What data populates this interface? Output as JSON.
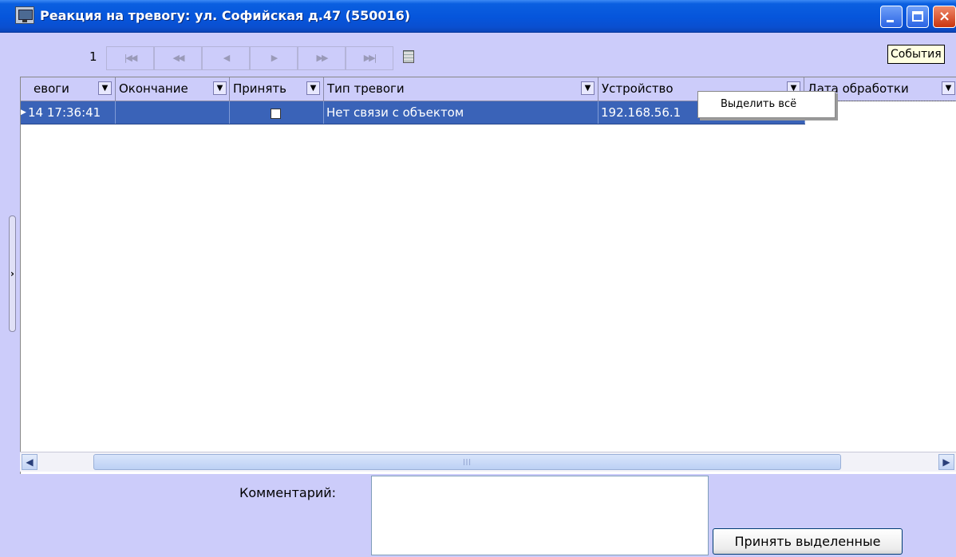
{
  "window": {
    "title": "Реакция на тревогу: ул. Софийская д.47 (550016)",
    "icon": "monitor-icon",
    "buttons": {
      "minimize": "minimize-icon",
      "maximize": "maximize-icon",
      "close": "×"
    }
  },
  "navigator": {
    "page": "1",
    "buttons": [
      {
        "name": "nav-first-button",
        "glyph": "|◀◀"
      },
      {
        "name": "nav-prev-page-button",
        "glyph": "◀◀"
      },
      {
        "name": "nav-prev-button",
        "glyph": "◀"
      },
      {
        "name": "nav-next-button",
        "glyph": "▶"
      },
      {
        "name": "nav-next-page-button",
        "glyph": "▶▶"
      },
      {
        "name": "nav-last-button",
        "glyph": "▶▶|"
      }
    ],
    "tooltip": "События"
  },
  "grid": {
    "columns": [
      "евоги",
      "Окончание",
      "Принять",
      "Тип тревоги",
      "Устройство",
      "Дата обработки"
    ],
    "dropdown_glyph": "▼",
    "rows": [
      {
        "start": "14 17:36:41",
        "end": "",
        "accepted": false,
        "type": "Нет связи с объектом",
        "device": "192.168.56.1",
        "processed": ""
      }
    ],
    "row_indicator": "▶"
  },
  "context_menu": {
    "items": [
      "Выделить всё"
    ]
  },
  "scrollbar": {
    "left": "◀",
    "right": "▶",
    "grip": "|||"
  },
  "comment": {
    "label": "Комментарий:",
    "value": ""
  },
  "accept_button": "Принять выделенные",
  "colors": {
    "background": "#ccccfa",
    "selection": "#3a63b8",
    "titlebar": "#0655db"
  }
}
